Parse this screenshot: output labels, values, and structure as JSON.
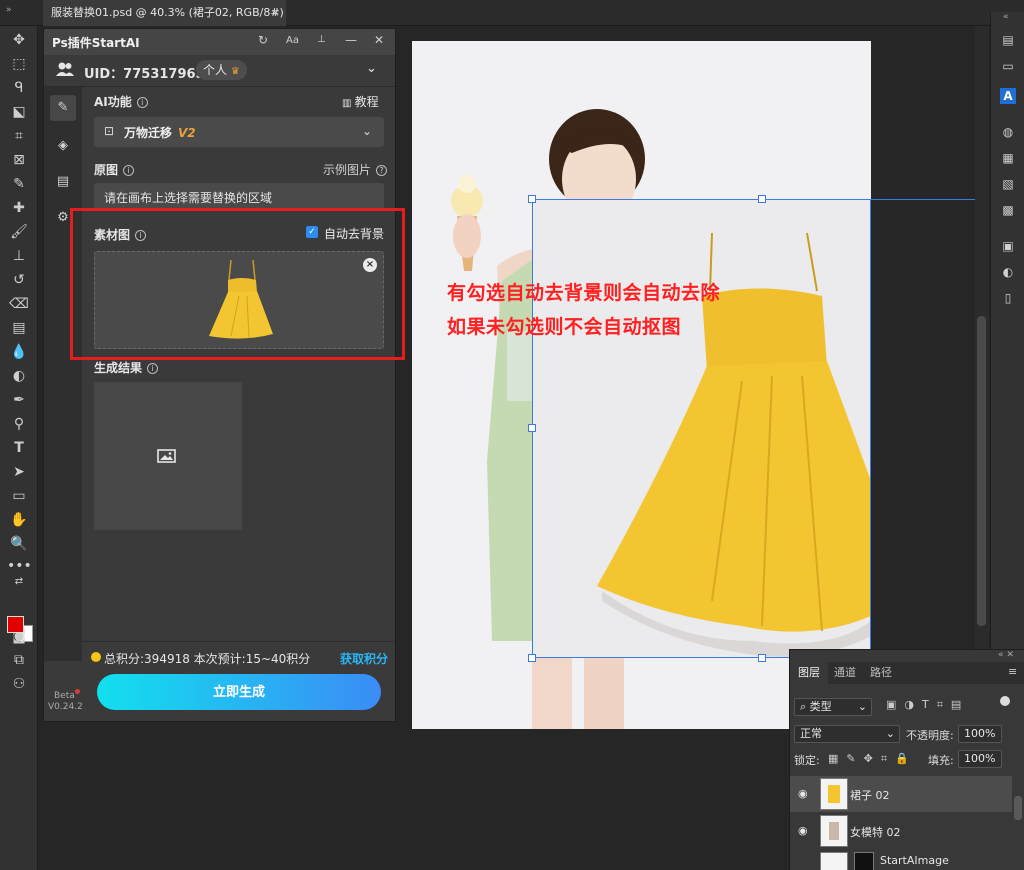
{
  "document_tab": {
    "title": "服装替换01.psd @ 40.3% (裙子02, RGB/8#) *",
    "close": "×"
  },
  "plugin": {
    "title": "Ps插件StartAI",
    "header_icons": {
      "refresh": "↻",
      "font": "Aa",
      "pin": "📌",
      "minimize": "—",
      "close": "✕"
    },
    "uid_label": "UID：775317965",
    "account_type": "个人",
    "ai_function_label": "AI功能",
    "tutorial_label": "教程",
    "function_select": {
      "value": "万物迁移",
      "version": "V2"
    },
    "original_label": "原图",
    "example_label": "示例图片",
    "original_placeholder": "请在画布上选择需要替换的区域",
    "material_label": "素材图",
    "auto_remove_bg_label": "自动去背景",
    "auto_remove_bg_checked": true,
    "result_label": "生成结果",
    "points_text": "总积分:394918  本次预计:15~40积分",
    "get_points_label": "获取积分",
    "generate_button": "立即生成",
    "beta_label": "Beta",
    "version": "V0.24.2"
  },
  "canvas": {
    "annotation_line1": "有勾选自动去背景则会自动去除",
    "annotation_line2": "如果未勾选则不会自动抠图"
  },
  "layers_panel": {
    "tabs": [
      "图层",
      "通道",
      "路径"
    ],
    "active_tab": "图层",
    "filter_type": "类型",
    "blend_mode": "正常",
    "opacity_label": "不透明度:",
    "opacity_value": "100%",
    "lock_label": "锁定:",
    "fill_label": "填充:",
    "fill_value": "100%",
    "layers": [
      {
        "name": "裙子 02",
        "selected": true
      },
      {
        "name": "女模特 02",
        "selected": false
      },
      {
        "name": "StartAImage",
        "selected": false
      }
    ]
  },
  "colors": {
    "accent": "#2bb5f5",
    "annotation_red": "#e41e1e",
    "foreground": "#e10000",
    "background": "#ffffff",
    "dress_yellow": "#f2c531"
  }
}
